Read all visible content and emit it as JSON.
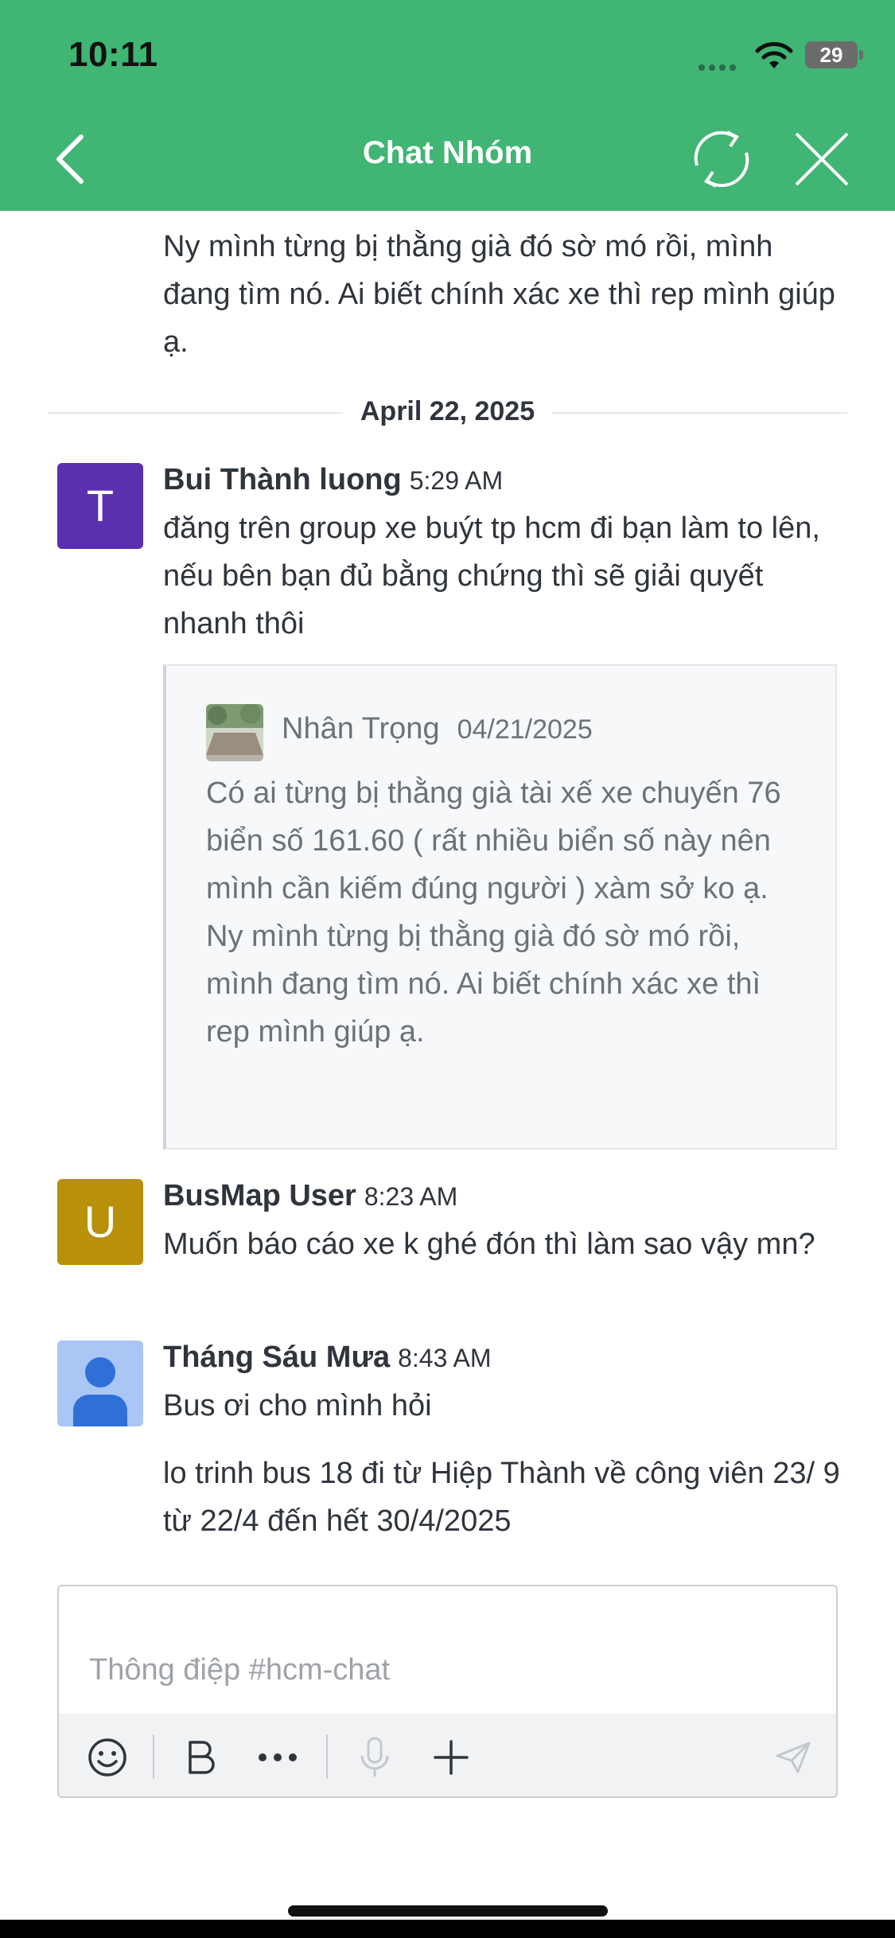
{
  "status_bar": {
    "time": "10:11",
    "battery": "29"
  },
  "header": {
    "title": "Chat Nhóm"
  },
  "colors": {
    "header_bg": "#40b574",
    "avatar_t": "#5a2fb0",
    "avatar_u": "#b8900a",
    "avatar_user": "#a9c6f5"
  },
  "messages": {
    "continued": {
      "clipped": "… … … … …, … … … … …",
      "text": "Ny mình từng bị thằng già đó sờ mó rồi, mình đang tìm nó. Ai biết chính xác xe thì rep mình giúp ạ."
    },
    "date_separator": "April 22, 2025",
    "items": [
      {
        "avatar_letter": "T",
        "name": "Bui Thành luong",
        "time": "5:29 AM",
        "text": "đăng trên group xe buýt tp hcm đi bạn làm to lên, nếu bên bạn đủ bằng chứng thì sẽ giải quyết nhanh thôi",
        "quote": {
          "name": "Nhân Trọng",
          "date": "04/21/2025",
          "text": "Có ai từng bị thằng già tài xế xe chuyến 76 biển số 161.60 ( rất nhiều biển số này nên mình cần kiếm đúng người ) xàm sở ko ạ. Ny mình từng bị thằng già đó sờ mó rồi, mình đang tìm nó. Ai biết chính xác xe thì rep mình giúp ạ."
        }
      },
      {
        "avatar_letter": "U",
        "name": "BusMap User",
        "time": "8:23 AM",
        "text": "Muốn báo cáo xe k ghé đón thì làm sao vậy mn?"
      },
      {
        "name": "Tháng Sáu Mưa",
        "time": "8:43 AM",
        "text": "Bus ơi cho mình hỏi",
        "text2": "lo trinh bus 18 đi từ Hiệp Thành về công viên 23/ 9 từ 22/4 đến hết 30/4/2025"
      }
    ]
  },
  "composer": {
    "placeholder": "Thông điệp #hcm-chat"
  }
}
